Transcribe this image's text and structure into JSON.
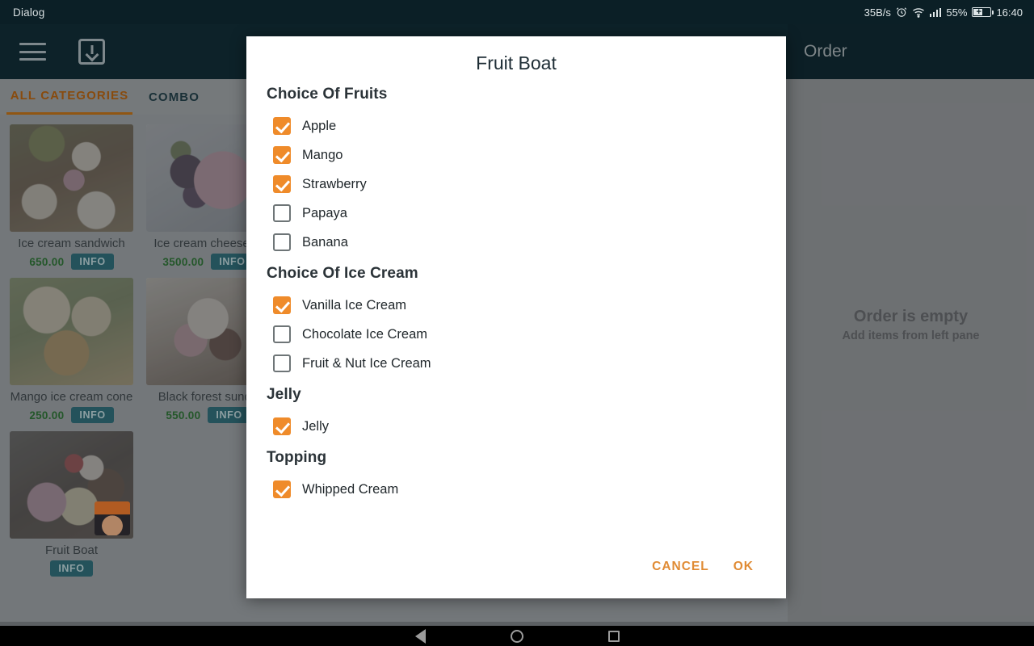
{
  "statusbar": {
    "window_label": "Dialog",
    "network_speed": "35B/s",
    "alarm_icon": "alarm-icon",
    "wifi_icon": "wifi-icon",
    "signal_icon": "signal-bars-icon",
    "battery_percent": "55%",
    "battery_icon": "battery-charging-icon",
    "clock": "16:40"
  },
  "app": {
    "toolbar": {
      "menu_icon": "hamburger-menu-icon",
      "inbox_icon": "download-inbox-icon"
    },
    "tabs": [
      {
        "label": "ALL CATEGORIES",
        "active": true
      },
      {
        "label": "COMBO",
        "active": false
      }
    ],
    "products": [
      {
        "name": "Ice cream sandwich",
        "price": "650.00",
        "info_label": "INFO",
        "image": "ice-cream-sandwich-photo"
      },
      {
        "name": "Ice cream cheeseca",
        "price": "3500.00",
        "info_label": "INFO",
        "image": "ice-cream-cheesecake-photo"
      },
      {
        "name": "Mango ice cream cone",
        "price": "250.00",
        "info_label": "INFO",
        "image": "mango-ice-cream-cone-photo"
      },
      {
        "name": "Black forest sunda",
        "price": "550.00",
        "info_label": "INFO",
        "image": "black-forest-sundae-photo"
      },
      {
        "name": "Fruit Boat",
        "price": "",
        "info_label": "INFO",
        "image": "fruit-boat-photo"
      }
    ],
    "order_panel": {
      "title": "Order",
      "empty_title": "Order is empty",
      "empty_subtitle": "Add items from left pane"
    }
  },
  "dialog": {
    "title": "Fruit Boat",
    "groups": [
      {
        "title": "Choice Of Fruits",
        "options": [
          {
            "label": "Apple",
            "checked": true
          },
          {
            "label": "Mango",
            "checked": true
          },
          {
            "label": "Strawberry",
            "checked": true
          },
          {
            "label": "Papaya",
            "checked": false
          },
          {
            "label": "Banana",
            "checked": false
          }
        ]
      },
      {
        "title": "Choice Of Ice Cream",
        "options": [
          {
            "label": "Vanilla Ice Cream",
            "checked": true
          },
          {
            "label": "Chocolate Ice Cream",
            "checked": false
          },
          {
            "label": "Fruit & Nut Ice Cream",
            "checked": false
          }
        ]
      },
      {
        "title": "Jelly",
        "options": [
          {
            "label": "Jelly",
            "checked": true
          }
        ]
      },
      {
        "title": "Topping",
        "options": [
          {
            "label": "Whipped Cream",
            "checked": true
          }
        ]
      }
    ],
    "cancel_label": "CANCEL",
    "ok_label": "OK"
  },
  "navbar": {
    "back_icon": "back-triangle-icon",
    "home_icon": "home-circle-icon",
    "recents_icon": "recents-square-icon"
  },
  "colors": {
    "accent_orange": "#ef8b2a",
    "toolbar_dark": "#102a33",
    "price_green": "#2c6b34",
    "info_teal": "#2c6570"
  }
}
